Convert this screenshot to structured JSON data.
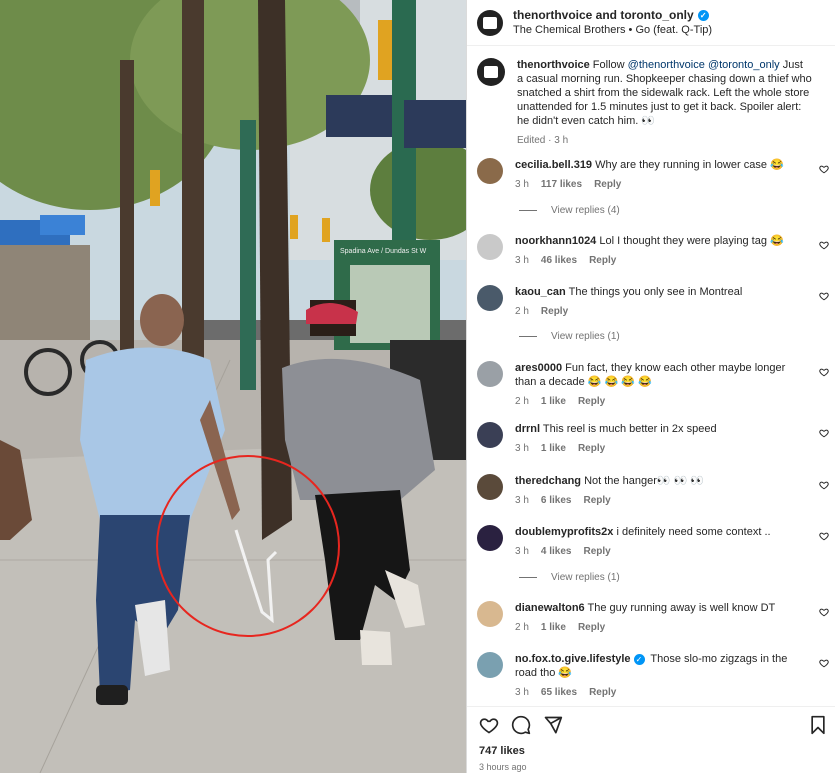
{
  "header": {
    "title": "thenorthvoice and toronto_only",
    "audio": "The Chemical Brothers • Go (feat. Q-Tip)"
  },
  "caption": {
    "username": "thenorthvoice",
    "text_before": "Follow",
    "mention1": "@thenorthvoice",
    "mention2": "@toronto_only",
    "text_after": "Just a casual morning run. Shopkeeper chasing down a thief who snatched a shirt from the sidewalk rack. Left the whole store unattended for 1.5 minutes just to get it back. Spoiler alert: he didn't even catch him. 👀",
    "meta": "Edited · 3 h"
  },
  "comments": [
    {
      "username": "cecilia.bell.319",
      "text": "Why are they running in lower case 😂",
      "time": "3 h",
      "likes": "117 likes",
      "reply": "Reply",
      "view_replies": "View replies (4)",
      "avatar_color": "#8a6a4a",
      "verified": false
    },
    {
      "username": "noorkhann1024",
      "text": "Lol I thought they were playing tag 😂",
      "time": "3 h",
      "likes": "46 likes",
      "reply": "Reply",
      "view_replies": "",
      "avatar_color": "#c9c9c9",
      "verified": false
    },
    {
      "username": "kaou_can",
      "text": "The things you only see in Montreal",
      "time": "2 h",
      "likes": "",
      "reply": "Reply",
      "view_replies": "View replies (1)",
      "avatar_color": "#4a5a6a",
      "verified": false
    },
    {
      "username": "ares0000",
      "text": "Fun fact, they know each other maybe longer than a decade 😂 😂 😂 😂",
      "time": "2 h",
      "likes": "1 like",
      "reply": "Reply",
      "view_replies": "",
      "avatar_color": "#9aa0a6",
      "verified": false
    },
    {
      "username": "drrnl",
      "text": "This reel is much better in 2x speed",
      "time": "3 h",
      "likes": "1 like",
      "reply": "Reply",
      "view_replies": "",
      "avatar_color": "#3a3f55",
      "verified": false
    },
    {
      "username": "theredchang",
      "text": "Not the hanger👀 👀 👀",
      "time": "3 h",
      "likes": "6 likes",
      "reply": "Reply",
      "view_replies": "",
      "avatar_color": "#5a4a3a",
      "verified": false
    },
    {
      "username": "doublemyprofits2x",
      "text": "i definitely need some context ..",
      "time": "3 h",
      "likes": "4 likes",
      "reply": "Reply",
      "view_replies": "View replies (1)",
      "avatar_color": "#2a2140",
      "verified": false
    },
    {
      "username": "dianewalton6",
      "text": "The guy running away is well know DT",
      "time": "2 h",
      "likes": "1 like",
      "reply": "Reply",
      "view_replies": "",
      "avatar_color": "#d8b890",
      "verified": false
    },
    {
      "username": "no.fox.to.give.lifestyle",
      "text": "Those slo-mo zigzags in the road tho 😂",
      "time": "3 h",
      "likes": "65 likes",
      "reply": "Reply",
      "view_replies": "",
      "avatar_color": "#7aa0b0",
      "verified": true
    }
  ],
  "footer": {
    "likes": "747 likes",
    "posted": "3 hours ago"
  },
  "media": {
    "sign_text": "Spadina Ave / Dundas St W"
  },
  "colors": {
    "accent_blue": "#0095f6",
    "circle_red": "#e7261f",
    "muted_text": "#737373"
  }
}
